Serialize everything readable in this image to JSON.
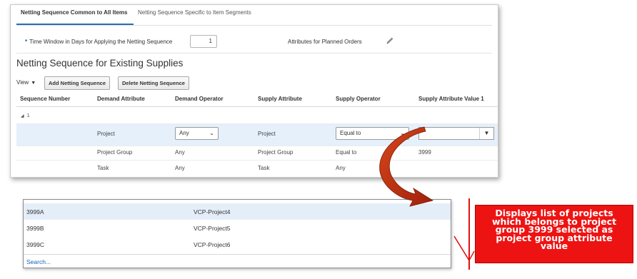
{
  "tabs": {
    "common": "Netting Sequence Common to All Items",
    "specific": "Netting Sequence Specific to Item Segments"
  },
  "time_window": {
    "label": "Time Window in Days for Applying the Netting Sequence",
    "value": "1"
  },
  "attributes_label": "Attributes for Planned Orders",
  "section_title": "Netting Sequence for Existing Supplies",
  "toolbar": {
    "view": "View",
    "add": "Add Netting Sequence",
    "delete": "Delete Netting Sequence"
  },
  "columns": [
    "Sequence Number",
    "Demand Attribute",
    "Demand Operator",
    "Supply Attribute",
    "Supply Operator",
    "Supply Attribute Value 1"
  ],
  "group": "1",
  "rows": [
    {
      "demand_attribute": "Project",
      "demand_operator": "Any",
      "supply_attribute": "Project",
      "supply_operator": "Equal to",
      "supply_value": ""
    },
    {
      "demand_attribute": "Project Group",
      "demand_operator": "Any",
      "supply_attribute": "Project Group",
      "supply_operator": "Equal to",
      "supply_value": "3999"
    },
    {
      "demand_attribute": "Task",
      "demand_operator": "Any",
      "supply_attribute": "Task",
      "supply_operator": "Any",
      "supply_value": ""
    }
  ],
  "dropdown": {
    "items": [
      {
        "code": "3999A",
        "name": "VCP-Project4"
      },
      {
        "code": "3999B",
        "name": "VCP-Project5"
      },
      {
        "code": "3999C",
        "name": "VCP-Project6"
      }
    ],
    "search": "Search..."
  },
  "callout": {
    "lines": [
      "Displays list of projects",
      "which belongs to project",
      "group 3999 selected as",
      "project group attribute",
      "value"
    ]
  },
  "colors": {
    "accent": "#2b6cb0",
    "highlight_row": "#e5f0fb",
    "callout": "#ee1313",
    "arrow": "#b52a10"
  },
  "icons": {
    "edit": "pencil-icon",
    "expand": "triangle-down-icon",
    "dropdown": "chevron-down-icon"
  }
}
